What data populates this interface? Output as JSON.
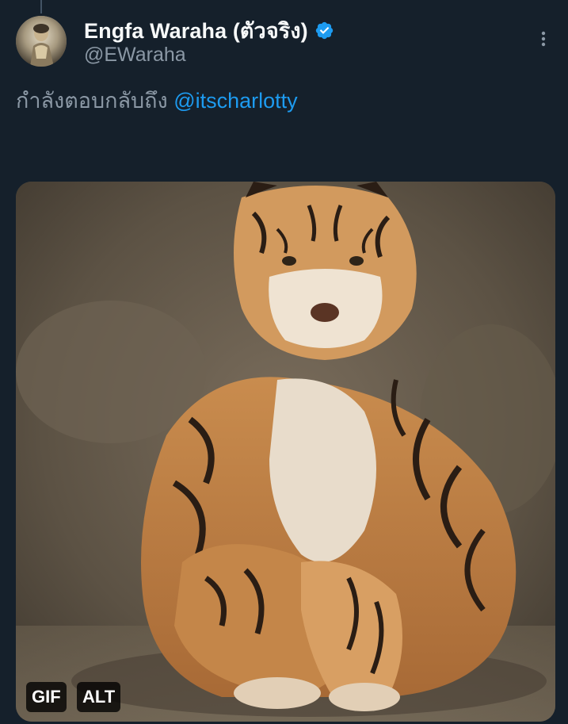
{
  "tweet": {
    "author": {
      "display_name": "Engfa Waraha (ตัวจริง)",
      "handle": "@EWaraha",
      "verified": true,
      "avatar_icon": "user-avatar"
    },
    "reply_context": {
      "prefix": "กำลังตอบกลับถึง",
      "mention": "@itscharlotty"
    },
    "media": {
      "type": "gif",
      "description_icon": "sitting-tiger-image",
      "badges": {
        "gif_label": "GIF",
        "alt_label": "ALT"
      }
    },
    "more_icon": "more-vertical-icon"
  },
  "colors": {
    "background": "#15202b",
    "primary_text": "#f7f9f9",
    "secondary_text": "#8b98a5",
    "accent": "#1d9bf0",
    "verified_badge": "#1d9bf0"
  }
}
